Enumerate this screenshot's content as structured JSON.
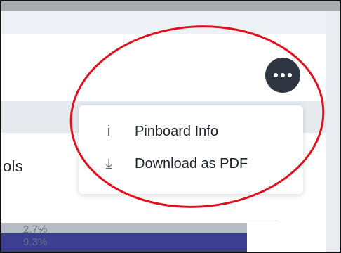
{
  "menu": {
    "items": [
      {
        "icon": "info-icon",
        "glyph": "i",
        "label": "Pinboard Info"
      },
      {
        "icon": "download-icon",
        "glyph": "⤓",
        "label": "Download as PDF"
      }
    ]
  },
  "card": {
    "title_partial": "ols"
  },
  "chart": {
    "labels": [
      "2.7%",
      "9.3%"
    ]
  },
  "colors": {
    "more_button": "#2f3541",
    "annotation": "#e0101d",
    "bar_primary": "#3c3e92",
    "bar_secondary": "#b7bdc7"
  }
}
